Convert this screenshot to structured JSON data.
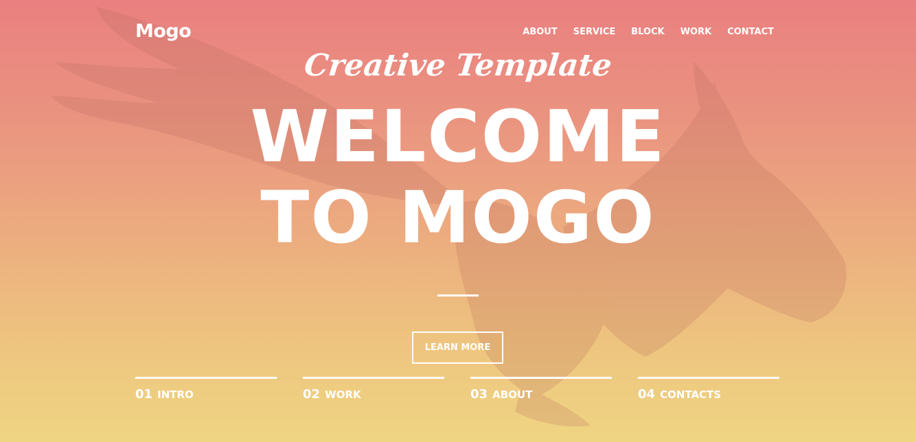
{
  "brand": {
    "logo": "Mogo"
  },
  "nav": {
    "items": [
      {
        "label": "ABOUT"
      },
      {
        "label": "SERVICE"
      },
      {
        "label": "BLOCK"
      },
      {
        "label": "WORK"
      },
      {
        "label": "CONTACT"
      }
    ]
  },
  "hero": {
    "subtitle": "Creative Template",
    "title_line1": "WELCOME",
    "title_line2": "TO MOGO",
    "button_label": "LEARN MORE"
  },
  "slides": [
    {
      "number": "01",
      "label": "INTRO"
    },
    {
      "number": "02",
      "label": "WORK"
    },
    {
      "number": "03",
      "label": "ABOUT"
    },
    {
      "number": "04",
      "label": "CONTACTS"
    }
  ],
  "colors": {
    "gradient_top": "#ea8080",
    "gradient_bottom": "#efd583",
    "text": "#ffffff"
  }
}
